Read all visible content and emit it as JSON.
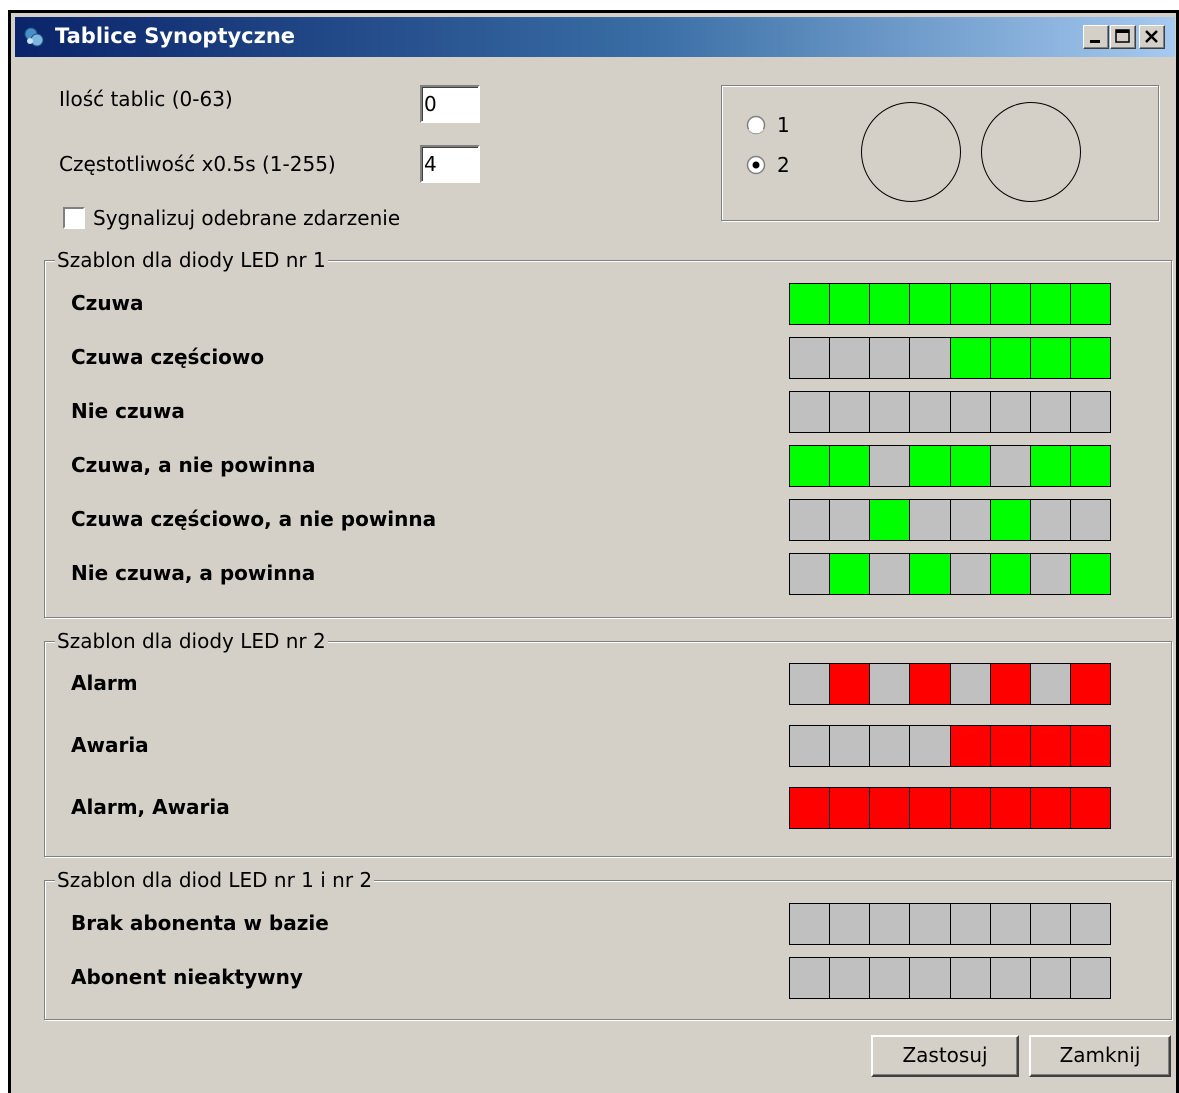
{
  "window": {
    "title": "Tablice Synoptyczne",
    "controls": {
      "minimize": "minimize",
      "maximize": "maximize",
      "close": "close"
    }
  },
  "settings": {
    "count_label": "Ilość tablic (0-63)",
    "count_value": "0",
    "freq_label": "Częstotliwość x0.5s (1-255)",
    "freq_value": "4",
    "signal_checkbox_label": "Sygnalizuj odebrane zdarzenie",
    "signal_checked": false
  },
  "preview": {
    "options": [
      {
        "label": "1",
        "selected": false
      },
      {
        "label": "2",
        "selected": true
      }
    ]
  },
  "colors": {
    "off": "#c0c0c0",
    "green": "#00ff00",
    "red": "#ff0000"
  },
  "groups": [
    {
      "legend": "Szablon dla diody LED nr 1",
      "rows": [
        {
          "label": "Czuwa",
          "pattern": [
            "green",
            "green",
            "green",
            "green",
            "green",
            "green",
            "green",
            "green"
          ]
        },
        {
          "label": "Czuwa częściowo",
          "pattern": [
            "off",
            "off",
            "off",
            "off",
            "green",
            "green",
            "green",
            "green"
          ]
        },
        {
          "label": "Nie czuwa",
          "pattern": [
            "off",
            "off",
            "off",
            "off",
            "off",
            "off",
            "off",
            "off"
          ]
        },
        {
          "label": "Czuwa, a nie powinna",
          "pattern": [
            "green",
            "green",
            "off",
            "green",
            "green",
            "off",
            "green",
            "green"
          ]
        },
        {
          "label": "Czuwa częściowo, a nie powinna",
          "pattern": [
            "off",
            "off",
            "green",
            "off",
            "off",
            "green",
            "off",
            "off"
          ]
        },
        {
          "label": "Nie czuwa, a powinna",
          "pattern": [
            "off",
            "green",
            "off",
            "green",
            "off",
            "green",
            "off",
            "green"
          ]
        }
      ]
    },
    {
      "legend": "Szablon dla diody LED nr 2",
      "rows": [
        {
          "label": "Alarm",
          "pattern": [
            "off",
            "red",
            "off",
            "red",
            "off",
            "red",
            "off",
            "red"
          ]
        },
        {
          "label": "Awaria",
          "pattern": [
            "off",
            "off",
            "off",
            "off",
            "red",
            "red",
            "red",
            "red"
          ]
        },
        {
          "label": "Alarm, Awaria",
          "pattern": [
            "red",
            "red",
            "red",
            "red",
            "red",
            "red",
            "red",
            "red"
          ]
        }
      ]
    },
    {
      "legend": "Szablon dla diod LED nr 1 i nr 2",
      "rows": [
        {
          "label": "Brak abonenta w bazie",
          "pattern": [
            "off",
            "off",
            "off",
            "off",
            "off",
            "off",
            "off",
            "off"
          ]
        },
        {
          "label": "Abonent nieaktywny",
          "pattern": [
            "off",
            "off",
            "off",
            "off",
            "off",
            "off",
            "off",
            "off"
          ]
        }
      ]
    }
  ],
  "buttons": {
    "apply": "Zastosuj",
    "close": "Zamknij"
  }
}
